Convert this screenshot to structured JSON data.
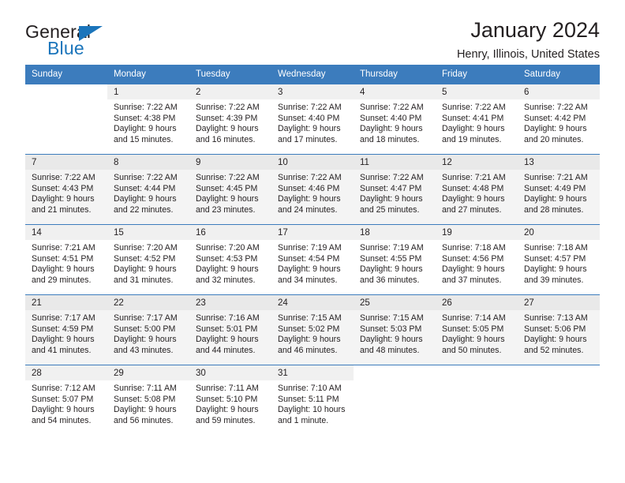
{
  "brand": {
    "name_top": "General",
    "name_bottom": "Blue",
    "triangle_color": "#1b75bb"
  },
  "header": {
    "month_title": "January 2024",
    "location": "Henry, Illinois, United States"
  },
  "theme": {
    "header_blue": "#3c7cbd",
    "row_shade": "#f4f4f4",
    "daynum_strip": "#f0f0f0",
    "text": "#231f20"
  },
  "labels": {
    "sunrise_prefix": "Sunrise:",
    "sunset_prefix": "Sunset:",
    "daylight_prefix": "Daylight:"
  },
  "weekday_headers": [
    "Sunday",
    "Monday",
    "Tuesday",
    "Wednesday",
    "Thursday",
    "Friday",
    "Saturday"
  ],
  "weeks": [
    {
      "shaded": false,
      "days": [
        {
          "date": "",
          "sunrise": "",
          "sunset": "",
          "daylight": ""
        },
        {
          "date": "1",
          "sunrise": "Sunrise: 7:22 AM",
          "sunset": "Sunset: 4:38 PM",
          "daylight": "Daylight: 9 hours and 15 minutes."
        },
        {
          "date": "2",
          "sunrise": "Sunrise: 7:22 AM",
          "sunset": "Sunset: 4:39 PM",
          "daylight": "Daylight: 9 hours and 16 minutes."
        },
        {
          "date": "3",
          "sunrise": "Sunrise: 7:22 AM",
          "sunset": "Sunset: 4:40 PM",
          "daylight": "Daylight: 9 hours and 17 minutes."
        },
        {
          "date": "4",
          "sunrise": "Sunrise: 7:22 AM",
          "sunset": "Sunset: 4:40 PM",
          "daylight": "Daylight: 9 hours and 18 minutes."
        },
        {
          "date": "5",
          "sunrise": "Sunrise: 7:22 AM",
          "sunset": "Sunset: 4:41 PM",
          "daylight": "Daylight: 9 hours and 19 minutes."
        },
        {
          "date": "6",
          "sunrise": "Sunrise: 7:22 AM",
          "sunset": "Sunset: 4:42 PM",
          "daylight": "Daylight: 9 hours and 20 minutes."
        }
      ]
    },
    {
      "shaded": true,
      "days": [
        {
          "date": "7",
          "sunrise": "Sunrise: 7:22 AM",
          "sunset": "Sunset: 4:43 PM",
          "daylight": "Daylight: 9 hours and 21 minutes."
        },
        {
          "date": "8",
          "sunrise": "Sunrise: 7:22 AM",
          "sunset": "Sunset: 4:44 PM",
          "daylight": "Daylight: 9 hours and 22 minutes."
        },
        {
          "date": "9",
          "sunrise": "Sunrise: 7:22 AM",
          "sunset": "Sunset: 4:45 PM",
          "daylight": "Daylight: 9 hours and 23 minutes."
        },
        {
          "date": "10",
          "sunrise": "Sunrise: 7:22 AM",
          "sunset": "Sunset: 4:46 PM",
          "daylight": "Daylight: 9 hours and 24 minutes."
        },
        {
          "date": "11",
          "sunrise": "Sunrise: 7:22 AM",
          "sunset": "Sunset: 4:47 PM",
          "daylight": "Daylight: 9 hours and 25 minutes."
        },
        {
          "date": "12",
          "sunrise": "Sunrise: 7:21 AM",
          "sunset": "Sunset: 4:48 PM",
          "daylight": "Daylight: 9 hours and 27 minutes."
        },
        {
          "date": "13",
          "sunrise": "Sunrise: 7:21 AM",
          "sunset": "Sunset: 4:49 PM",
          "daylight": "Daylight: 9 hours and 28 minutes."
        }
      ]
    },
    {
      "shaded": false,
      "days": [
        {
          "date": "14",
          "sunrise": "Sunrise: 7:21 AM",
          "sunset": "Sunset: 4:51 PM",
          "daylight": "Daylight: 9 hours and 29 minutes."
        },
        {
          "date": "15",
          "sunrise": "Sunrise: 7:20 AM",
          "sunset": "Sunset: 4:52 PM",
          "daylight": "Daylight: 9 hours and 31 minutes."
        },
        {
          "date": "16",
          "sunrise": "Sunrise: 7:20 AM",
          "sunset": "Sunset: 4:53 PM",
          "daylight": "Daylight: 9 hours and 32 minutes."
        },
        {
          "date": "17",
          "sunrise": "Sunrise: 7:19 AM",
          "sunset": "Sunset: 4:54 PM",
          "daylight": "Daylight: 9 hours and 34 minutes."
        },
        {
          "date": "18",
          "sunrise": "Sunrise: 7:19 AM",
          "sunset": "Sunset: 4:55 PM",
          "daylight": "Daylight: 9 hours and 36 minutes."
        },
        {
          "date": "19",
          "sunrise": "Sunrise: 7:18 AM",
          "sunset": "Sunset: 4:56 PM",
          "daylight": "Daylight: 9 hours and 37 minutes."
        },
        {
          "date": "20",
          "sunrise": "Sunrise: 7:18 AM",
          "sunset": "Sunset: 4:57 PM",
          "daylight": "Daylight: 9 hours and 39 minutes."
        }
      ]
    },
    {
      "shaded": true,
      "days": [
        {
          "date": "21",
          "sunrise": "Sunrise: 7:17 AM",
          "sunset": "Sunset: 4:59 PM",
          "daylight": "Daylight: 9 hours and 41 minutes."
        },
        {
          "date": "22",
          "sunrise": "Sunrise: 7:17 AM",
          "sunset": "Sunset: 5:00 PM",
          "daylight": "Daylight: 9 hours and 43 minutes."
        },
        {
          "date": "23",
          "sunrise": "Sunrise: 7:16 AM",
          "sunset": "Sunset: 5:01 PM",
          "daylight": "Daylight: 9 hours and 44 minutes."
        },
        {
          "date": "24",
          "sunrise": "Sunrise: 7:15 AM",
          "sunset": "Sunset: 5:02 PM",
          "daylight": "Daylight: 9 hours and 46 minutes."
        },
        {
          "date": "25",
          "sunrise": "Sunrise: 7:15 AM",
          "sunset": "Sunset: 5:03 PM",
          "daylight": "Daylight: 9 hours and 48 minutes."
        },
        {
          "date": "26",
          "sunrise": "Sunrise: 7:14 AM",
          "sunset": "Sunset: 5:05 PM",
          "daylight": "Daylight: 9 hours and 50 minutes."
        },
        {
          "date": "27",
          "sunrise": "Sunrise: 7:13 AM",
          "sunset": "Sunset: 5:06 PM",
          "daylight": "Daylight: 9 hours and 52 minutes."
        }
      ]
    },
    {
      "shaded": false,
      "days": [
        {
          "date": "28",
          "sunrise": "Sunrise: 7:12 AM",
          "sunset": "Sunset: 5:07 PM",
          "daylight": "Daylight: 9 hours and 54 minutes."
        },
        {
          "date": "29",
          "sunrise": "Sunrise: 7:11 AM",
          "sunset": "Sunset: 5:08 PM",
          "daylight": "Daylight: 9 hours and 56 minutes."
        },
        {
          "date": "30",
          "sunrise": "Sunrise: 7:11 AM",
          "sunset": "Sunset: 5:10 PM",
          "daylight": "Daylight: 9 hours and 59 minutes."
        },
        {
          "date": "31",
          "sunrise": "Sunrise: 7:10 AM",
          "sunset": "Sunset: 5:11 PM",
          "daylight": "Daylight: 10 hours and 1 minute."
        },
        {
          "date": "",
          "sunrise": "",
          "sunset": "",
          "daylight": ""
        },
        {
          "date": "",
          "sunrise": "",
          "sunset": "",
          "daylight": ""
        },
        {
          "date": "",
          "sunrise": "",
          "sunset": "",
          "daylight": ""
        }
      ]
    }
  ]
}
